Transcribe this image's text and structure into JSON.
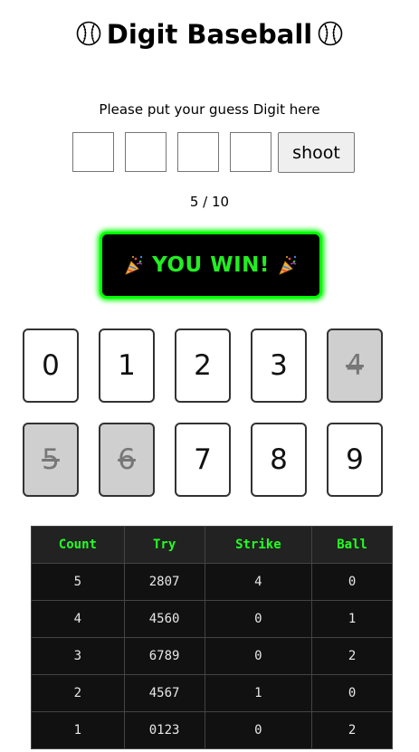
{
  "header": {
    "title": "Digit Baseball"
  },
  "guess": {
    "prompt": "Please put your guess Digit here",
    "inputs": [
      "",
      "",
      "",
      ""
    ],
    "shoot_label": "shoot"
  },
  "attempts": "5 / 10",
  "result": {
    "message": "YOU WIN!"
  },
  "digits": [
    {
      "label": "0",
      "used": false
    },
    {
      "label": "1",
      "used": false
    },
    {
      "label": "2",
      "used": false
    },
    {
      "label": "3",
      "used": false
    },
    {
      "label": "4",
      "used": true
    },
    {
      "label": "5",
      "used": true
    },
    {
      "label": "6",
      "used": true
    },
    {
      "label": "7",
      "used": false
    },
    {
      "label": "8",
      "used": false
    },
    {
      "label": "9",
      "used": false
    }
  ],
  "history": {
    "headers": [
      "Count",
      "Try",
      "Strike",
      "Ball"
    ],
    "rows": [
      [
        "5",
        "2807",
        "4",
        "0"
      ],
      [
        "4",
        "4560",
        "0",
        "1"
      ],
      [
        "3",
        "6789",
        "0",
        "2"
      ],
      [
        "2",
        "4567",
        "1",
        "0"
      ],
      [
        "1",
        "0123",
        "0",
        "2"
      ]
    ]
  },
  "colors": {
    "win_green": "#00ff00",
    "table_bg": "#111111",
    "header_text": "#22ff22",
    "used_card": "#cfcfcf"
  },
  "icons": {
    "title_left": "baseball-icon",
    "title_right": "baseball-icon",
    "banner_left": "party-popper-icon",
    "banner_right": "party-popper-icon"
  }
}
